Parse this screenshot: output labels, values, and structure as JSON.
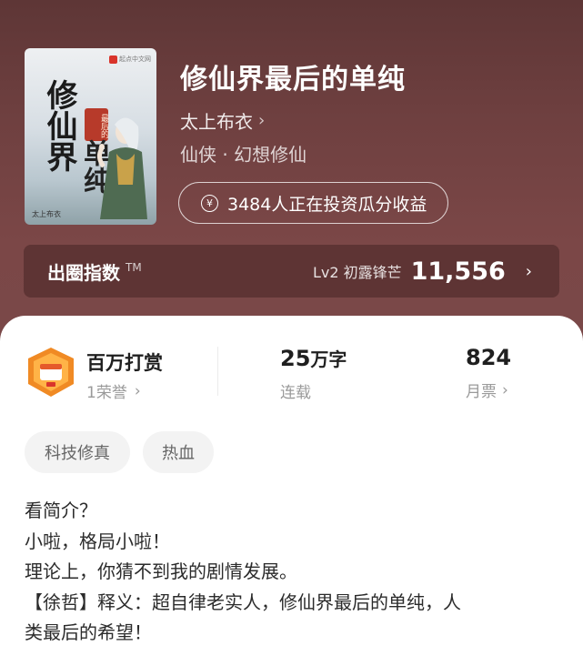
{
  "book": {
    "title": "修仙界最后的单纯",
    "author": "太上布衣",
    "genre": "仙侠 · 幻想修仙",
    "invest_text": "3484人正在投资瓜分收益",
    "cover": {
      "publisher": "起点中文网",
      "calligraphy_main": "修仙界",
      "calligraphy_second": "单纯",
      "seal_text": "最后的",
      "author_mark": "太上布衣"
    }
  },
  "index_bar": {
    "label": "出圈指数",
    "tm": "TM",
    "level": "Lv2 初露锋芒",
    "score": "11,556"
  },
  "stats": {
    "reward_title": "百万打赏",
    "reward_sub": "1荣誉",
    "words_num": "25",
    "words_unit": "万字",
    "words_label": "连载",
    "tickets_num": "824",
    "tickets_label": "月票"
  },
  "tags": [
    "科技修真",
    "热血"
  ],
  "intro": [
    "看简介？",
    "小啦，格局小啦！",
    "理论上，你猜不到我的剧情发展。",
    "【徐哲】释义：超自律老实人，修仙界最后的单纯，人",
    "类最后的希望！"
  ],
  "icons": {
    "invest": "yen-circle-icon",
    "chevron": "chevron-right-icon",
    "badge": "reward-badge-icon"
  },
  "colors": {
    "hero_bg": "#6f4040",
    "badge_orange": "#f08a24",
    "tag_bg": "#f3f3f3"
  }
}
